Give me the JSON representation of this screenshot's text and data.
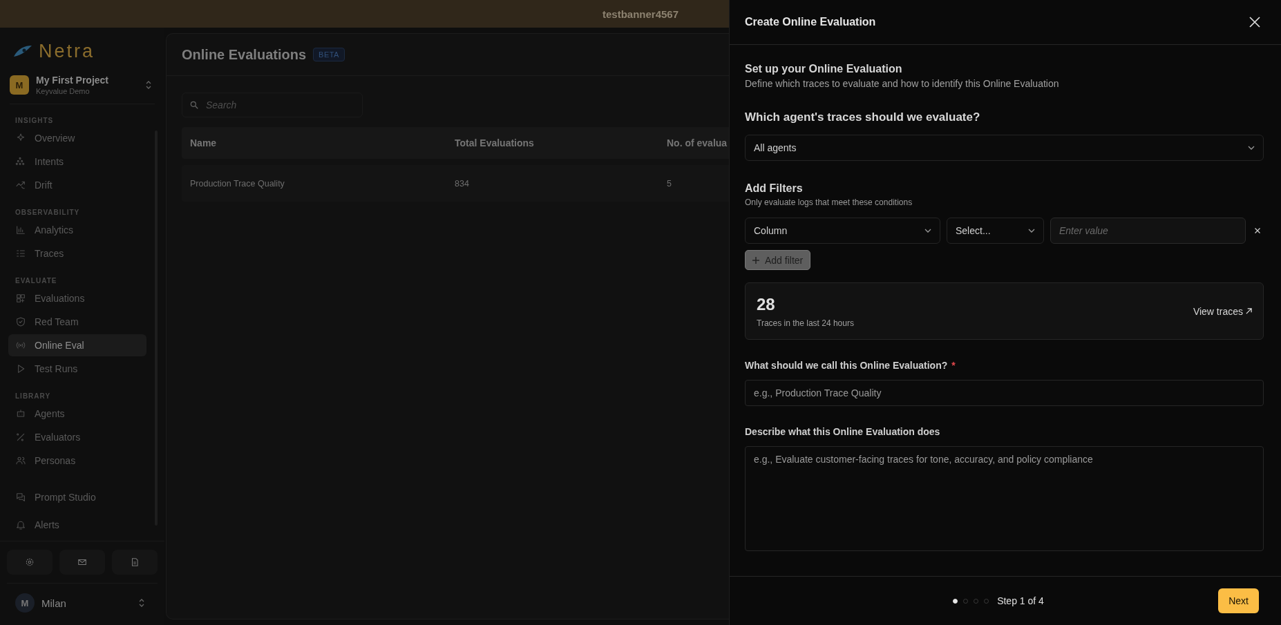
{
  "banner": {
    "text": "testbanner4567"
  },
  "sidebar": {
    "logo": "Netra",
    "project": {
      "initial": "M",
      "name": "My First Project",
      "subtitle": "Keyvalue Demo"
    },
    "sections": [
      {
        "heading": "INSIGHTS",
        "items": [
          {
            "label": "Overview",
            "selected": false
          },
          {
            "label": "Intents",
            "selected": false
          },
          {
            "label": "Drift",
            "selected": false
          }
        ]
      },
      {
        "heading": "OBSERVABILITY",
        "items": [
          {
            "label": "Analytics",
            "selected": false
          },
          {
            "label": "Traces",
            "selected": false
          }
        ]
      },
      {
        "heading": "EVALUATE",
        "items": [
          {
            "label": "Evaluations",
            "selected": false
          },
          {
            "label": "Red Team",
            "selected": false
          },
          {
            "label": "Online Eval",
            "selected": true
          },
          {
            "label": "Test Runs",
            "selected": false
          }
        ]
      },
      {
        "heading": "LIBRARY",
        "items": [
          {
            "label": "Agents",
            "selected": false
          },
          {
            "label": "Evaluators",
            "selected": false
          },
          {
            "label": "Personas",
            "selected": false
          }
        ]
      },
      {
        "items": [
          {
            "label": "Prompt Studio",
            "selected": false
          },
          {
            "label": "Alerts",
            "selected": false
          }
        ]
      }
    ],
    "user": {
      "initial": "M",
      "name": "Milan"
    }
  },
  "page": {
    "title": "Online Evaluations",
    "badge": "BETA",
    "search": {
      "placeholder": "Search"
    },
    "table": {
      "columns": [
        "Name",
        "Total Evaluations",
        "No. of evalua"
      ],
      "rows": [
        [
          "Production Trace Quality",
          "834",
          "5"
        ]
      ]
    }
  },
  "drawer": {
    "title": "Create Online Evaluation",
    "intro": {
      "heading": "Set up your Online Evaluation",
      "text": "Define which traces to evaluate and how to identify this Online Evaluation"
    },
    "agent": {
      "question": "Which agent's traces should we evaluate?",
      "value": "All agents"
    },
    "filters": {
      "heading": "Add Filters",
      "subtitle": "Only evaluate logs that meet these conditions",
      "rows": [
        {
          "column": "Column",
          "operator": "Select...",
          "value": {
            "placeholder": "Enter value"
          }
        }
      ],
      "add_button": "Add filter"
    },
    "traces": {
      "count": "28",
      "caption": "Traces in the last 24 hours",
      "link": "View traces"
    },
    "name_field": {
      "label": "What should we call this Online Evaluation?",
      "required_mark": "*",
      "placeholder": "e.g., Production Trace Quality"
    },
    "description_field": {
      "label": "Describe what this Online Evaluation does",
      "placeholder": "e.g., Evaluate customer-facing traces for tone, accuracy, and policy compliance"
    },
    "stepper": {
      "steps": [
        {
          "selected": true
        },
        {
          "selected": false
        },
        {
          "selected": false
        },
        {
          "selected": false
        }
      ],
      "label": "Step 1 of 4"
    },
    "next_button": "Next"
  }
}
